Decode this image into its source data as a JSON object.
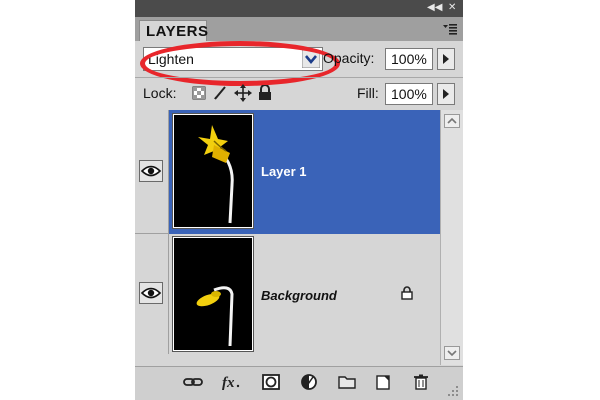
{
  "panel": {
    "tab_label": "LAYERS",
    "title_icons": [
      "collapse-icon",
      "close-icon"
    ],
    "menu_icon": "panel-menu-icon"
  },
  "blend_mode": {
    "selected": "Lighten"
  },
  "opacity": {
    "label": "Opacity:",
    "value": "100%"
  },
  "lock": {
    "label": "Lock:",
    "icons": [
      "lock-transparent-pixels-icon",
      "lock-image-pixels-icon",
      "lock-position-icon",
      "lock-all-icon"
    ]
  },
  "fill": {
    "label": "Fill:",
    "value": "100%"
  },
  "layers": [
    {
      "name": "Layer 1",
      "selected": true,
      "visible": true,
      "locked": false
    },
    {
      "name": "Background",
      "selected": false,
      "visible": true,
      "locked": true
    }
  ],
  "footer_icons": [
    "link-layers-icon",
    "layer-style-fx-icon",
    "add-mask-icon",
    "adjustment-layer-icon",
    "new-group-icon",
    "new-layer-icon",
    "delete-layer-icon"
  ],
  "colors": {
    "selected_row": "#3a63b8",
    "highlight_ring": "#e8262b",
    "panel_bg": "#d6d6d6"
  }
}
